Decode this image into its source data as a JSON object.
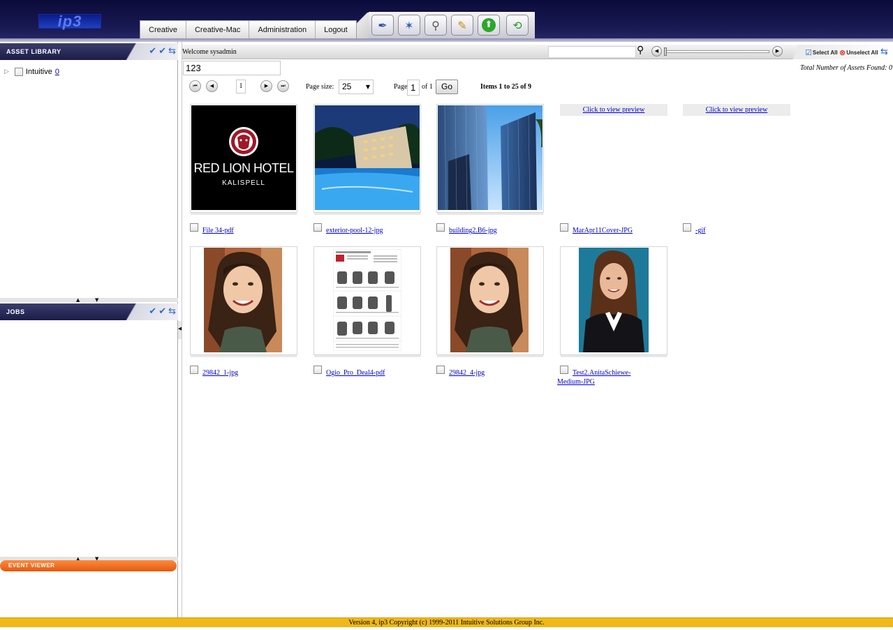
{
  "header": {
    "logo_text": "ip3",
    "tabs": [
      "Creative",
      "Creative-Mac",
      "Administration",
      "Logout"
    ],
    "toolbar_icons": [
      "pen-tool-icon",
      "magic-wand-icon",
      "magnifier-icon",
      "edit-note-icon",
      "upload-icon",
      "search-refresh-icon"
    ]
  },
  "left": {
    "asset_library_title": "ASSET LIBRARY",
    "tree": {
      "label": "Intuitive",
      "count": "0"
    },
    "jobs_title": "JOBS",
    "event_viewer_title": "EVENT VIEWER"
  },
  "main": {
    "welcome": "Welcome sysadmin",
    "select_all": "Select All",
    "unselect_all": "Unselect All",
    "query": "123",
    "total_found_label": "Total Number of Assets Found:",
    "total_found_value": "0",
    "pager": {
      "current_page_box": "1",
      "page_size_label": "Page size:",
      "page_size_value": "25",
      "page_label": "Page:",
      "page_input": "1",
      "page_of": "of 1",
      "go_label": "Go",
      "items_range": "Items 1 to 25 of 9"
    },
    "assets": [
      {
        "name": "File 34-pdf",
        "preview": "red-lion-logo"
      },
      {
        "name": "exterior-pool-12-jpg",
        "preview": "hotel-pool"
      },
      {
        "name": "building2.B6-jpg",
        "preview": "glass-towers"
      },
      {
        "name": "MarApr11Cover-JPG",
        "preview_link": "Click to view preview"
      },
      {
        "name": "-gif",
        "preview_link": "Click to view preview"
      },
      {
        "name": "29842_1-jpg",
        "preview": "portrait-girl"
      },
      {
        "name": "Ogio_Pro_Deal4-pdf",
        "preview": "backpack-catalog"
      },
      {
        "name": "29842_4-jpg",
        "preview": "portrait-girl"
      },
      {
        "name": "Test2.AnitaSchiewe-Medium-JPG",
        "preview": "portrait-woman"
      }
    ],
    "red_lion_logo_text": {
      "line1": "RED LION HOTEL",
      "line2": "KALISPELL"
    }
  },
  "footer": {
    "text": "Version 4, ip3 Copyright (c) 1999-2011 Intuitive Solutions Group Inc."
  },
  "colors": {
    "header_bg": "#14144a",
    "footer_bg": "#f0b818",
    "event_viewer": "#f07020",
    "link": "#0000cc"
  }
}
